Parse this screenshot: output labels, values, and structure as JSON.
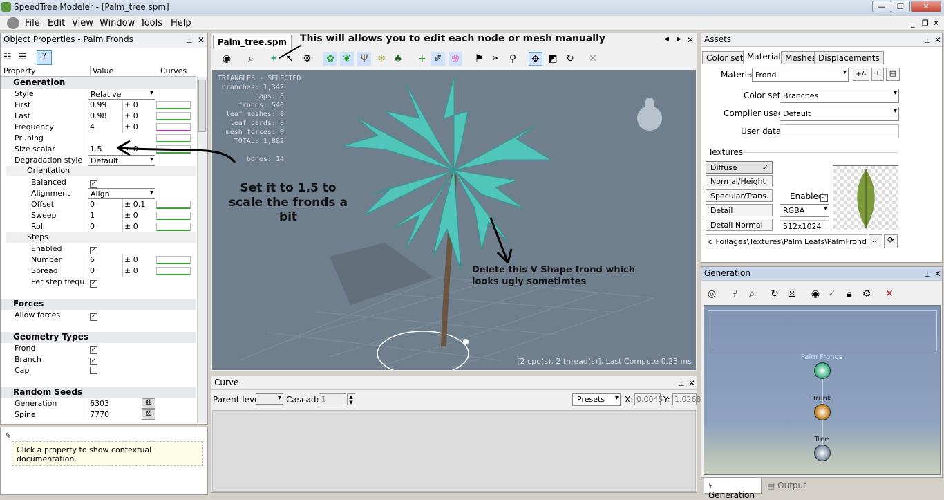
{
  "window": {
    "title": "SpeedTree Modeler - [Palm_tree.spm]"
  },
  "menu": [
    "File",
    "Edit",
    "View",
    "Window",
    "Tools",
    "Help"
  ],
  "left": {
    "title": "Object Properties - Palm Fronds",
    "columns": [
      "Property",
      "Value",
      "Curves"
    ],
    "generation": "Generation",
    "style": {
      "label": "Style",
      "value": "Relative"
    },
    "first": {
      "label": "First",
      "value": "0.99",
      "pm": "± 0"
    },
    "last": {
      "label": "Last",
      "value": "0.98",
      "pm": "± 0"
    },
    "frequency": {
      "label": "Frequency",
      "value": "4",
      "pm": "± 0"
    },
    "pruning": {
      "label": "Pruning"
    },
    "size_scalar": {
      "label": "Size scalar",
      "value": "1.5",
      "pm": "± 0"
    },
    "degradation": {
      "label": "Degradation style",
      "value": "Default"
    },
    "orientation": "Orientation",
    "balanced": {
      "label": "Balanced"
    },
    "alignment": {
      "label": "Alignment",
      "value": "Align"
    },
    "offset": {
      "label": "Offset",
      "value": "0",
      "pm": "± 0.1"
    },
    "sweep": {
      "label": "Sweep",
      "value": "1",
      "pm": "± 0"
    },
    "roll": {
      "label": "Roll",
      "value": "0",
      "pm": "± 0"
    },
    "steps": "Steps",
    "enabled": {
      "label": "Enabled"
    },
    "number": {
      "label": "Number",
      "value": "6",
      "pm": "± 0"
    },
    "spread": {
      "label": "Spread",
      "value": "0",
      "pm": "± 0"
    },
    "per_step": {
      "label": "Per step frequ..."
    },
    "forces": "Forces",
    "allow_forces": {
      "label": "Allow forces"
    },
    "geometry": "Geometry Types",
    "frond": {
      "label": "Frond"
    },
    "branch": {
      "label": "Branch"
    },
    "cap": {
      "label": "Cap"
    },
    "seeds": "Random Seeds",
    "seed_generation": {
      "label": "Generation",
      "value": "6303"
    },
    "seed_spine": {
      "label": "Spine",
      "value": "7770"
    },
    "help_text": "Click a property to show contextual documentation."
  },
  "center": {
    "tab": "Palm_tree.spm",
    "annotation_top": "This will allows you to edit each node or mesh manually",
    "annotation_left": "Set it to 1.5 to scale the fronds a bit",
    "annotation_right": "Delete this V Shape frond which looks ugly sometimtes",
    "stats": {
      "header": "TRIANGLES - SELECTED",
      "rows": [
        "branches: 1,342",
        "caps: 0",
        "fronds: 540",
        "leaf meshes: 0",
        "leaf cards: 0",
        "mesh forces: 0",
        "TOTAL: 1,882",
        "",
        "bones: 14"
      ]
    },
    "compute": "[2 cpu(s), 2 thread(s)], Last Compute 0.23 ms"
  },
  "curve": {
    "title": "Curve",
    "parent_level": "Parent level:",
    "cascade": "Cascade:",
    "cascade_value": "1",
    "presets": "Presets",
    "x_label": "X:",
    "x_value": "0.0045",
    "y_label": "Y:",
    "y_value": "1.0268"
  },
  "assets": {
    "title": "Assets",
    "tabs": [
      "Color sets",
      "Materials",
      "Meshes",
      "Displacements"
    ],
    "material_label": "Material",
    "material_value": "Frond",
    "colorset_label": "Color set",
    "colorset_value": "Branches",
    "compiler_label": "Compiler usage",
    "compiler_value": "Default",
    "userdata_label": "User data",
    "textures_label": "Textures",
    "tex_buttons": [
      "Diffuse",
      "Normal/Height",
      "Specular/Trans.",
      "Detail",
      "Detail Normal"
    ],
    "diffuse_check": "✓",
    "enabled_label": "Enabled",
    "format": "RGBA",
    "size": "512x1024",
    "path": "d Foilages\\Textures\\Palm Leafs\\PalmFrond.tga",
    "browse": "..."
  },
  "generation_panel": {
    "title": "Generation",
    "nodes": [
      "Palm Fronds",
      "Trunk",
      "Tree"
    ],
    "bottom_tabs": [
      "Generation",
      "Output"
    ]
  }
}
